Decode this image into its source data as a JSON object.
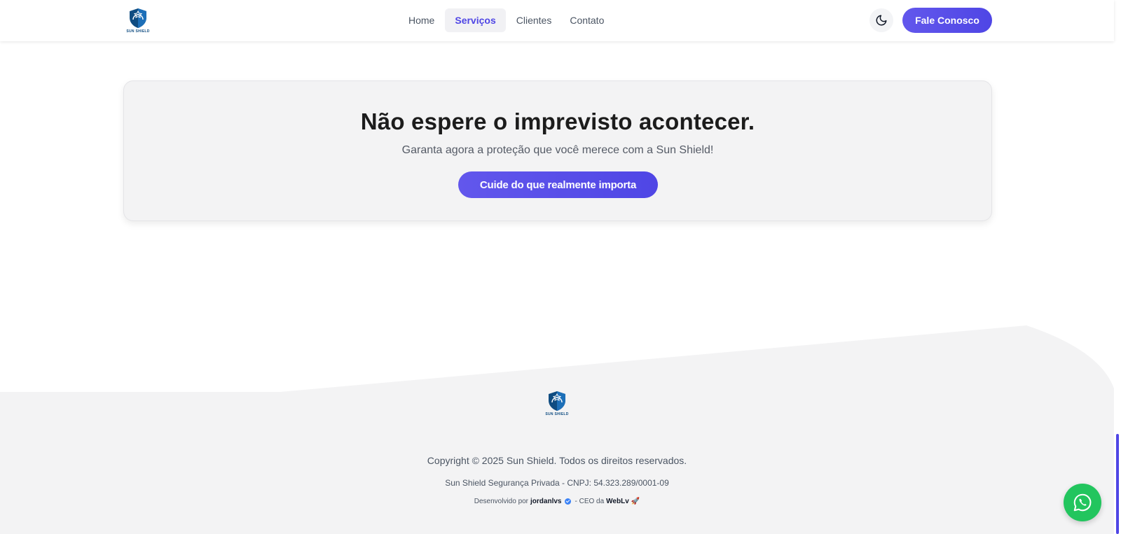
{
  "header": {
    "logo_text": "SUN SHIELD",
    "nav": [
      {
        "label": "Home",
        "active": false
      },
      {
        "label": "Serviços",
        "active": true
      },
      {
        "label": "Clientes",
        "active": false
      },
      {
        "label": "Contato",
        "active": false
      }
    ],
    "theme_icon": "moon-icon",
    "cta_label": "Fale Conosco"
  },
  "hero": {
    "title": "Não espere o imprevisto acontecer.",
    "subtitle": "Garanta agora a proteção que você merece com a Sun Shield!",
    "button_label": "Cuide do que realmente importa"
  },
  "footer": {
    "logo_text": "SUN SHIELD",
    "copyright": "Copyright © 2025 Sun Shield. Todos os direitos reservados.",
    "company": "Sun Shield Segurança Privada - CNPJ: 54.323.289/0001-09",
    "dev_prefix": "Desenvolvido por",
    "dev_name": "jordanlvs",
    "dev_middle": "- CEO da",
    "dev_company": "WebLv",
    "dev_emoji": "🚀"
  },
  "floating": {
    "whatsapp_icon": "whatsapp-icon"
  },
  "colors": {
    "accent": "#4f46e5",
    "accent_light": "#6257ec",
    "footer_bg": "#f3f3f4",
    "whatsapp": "#22c55e",
    "brand_navy": "#0f4c81"
  }
}
